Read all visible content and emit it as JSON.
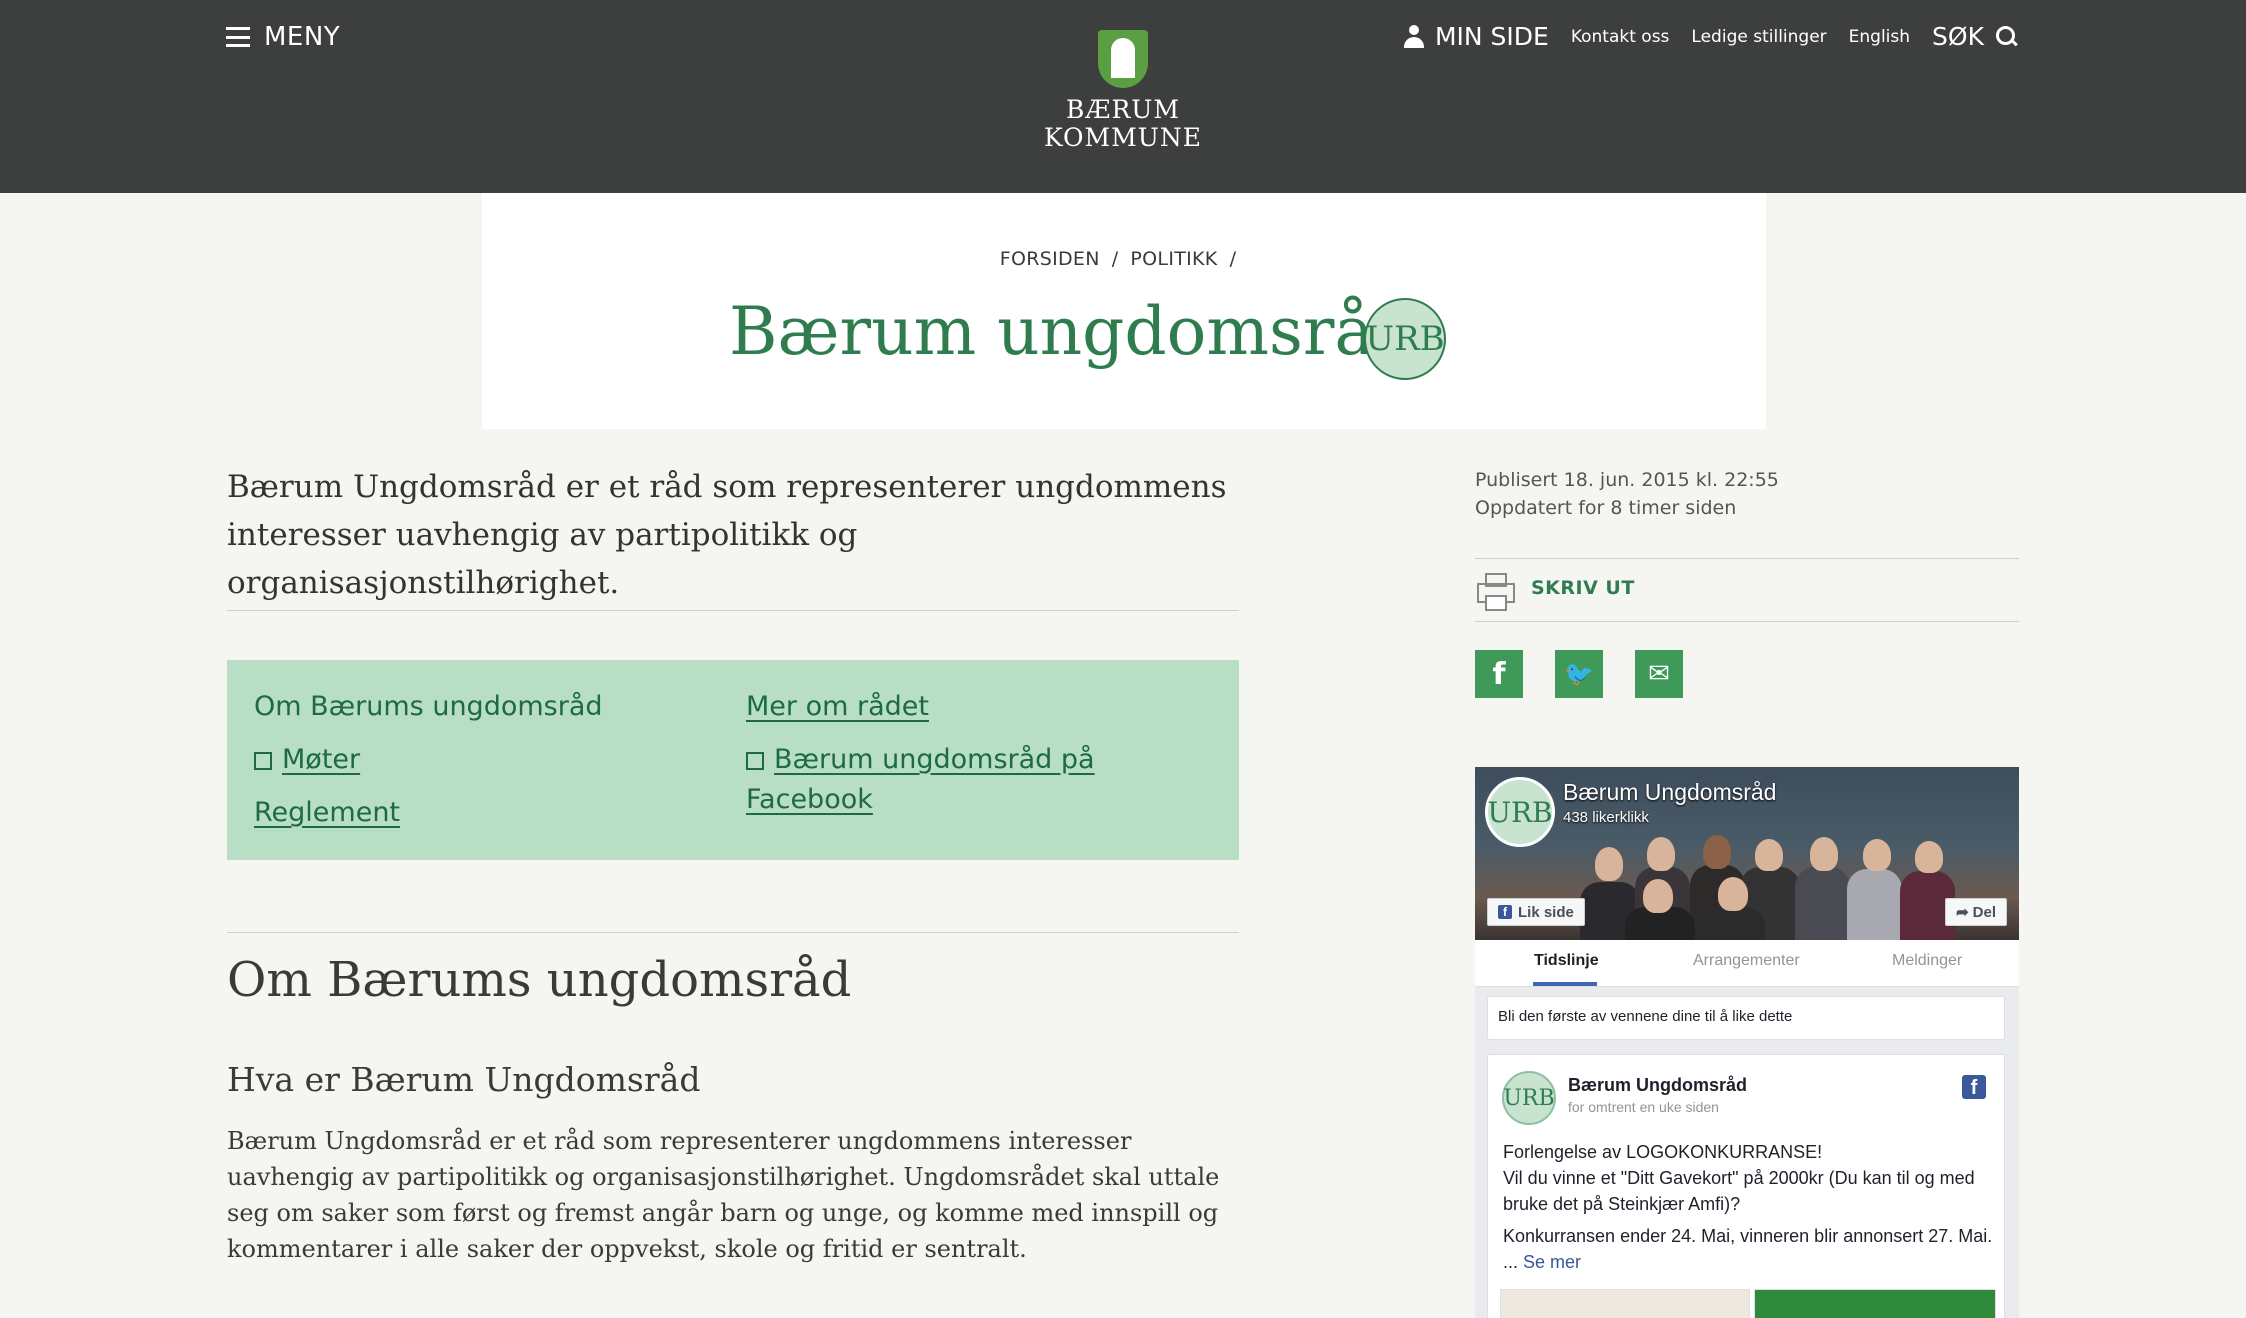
{
  "header": {
    "menu_label": "MENY",
    "logo_line1": "BÆRUM",
    "logo_line2": "KOMMUNE",
    "min_side": "MIN SIDE",
    "links": [
      "Kontakt oss",
      "Ledige stillinger",
      "English"
    ],
    "search_label": "SØK"
  },
  "breadcrumb": [
    "FORSIDEN",
    "POLITIKK"
  ],
  "page": {
    "title": "Bærum ungdomsråd",
    "badge": "URB",
    "intro": "Bærum Ungdomsråd er et råd som representerer ungdommens interesser uavhengig av partipolitikk og organisasjonstilhørighet."
  },
  "quicklinks": {
    "om": "Om Bærums ungdomsråd",
    "moter": "Møter",
    "reglement": "Reglement",
    "mer": "Mer om rådet",
    "facebook": "Bærum ungdomsråd på Facebook"
  },
  "content": {
    "h2": "Om Bærums ungdomsråd",
    "h3": "Hva er Bærum Ungdomsråd",
    "p1": "Bærum Ungdomsråd er et råd som representerer ungdommens interesser uavhengig av partipolitikk og organisasjonstilhørighet. Ungdomsrådet skal uttale seg om saker som først og fremst angår barn og unge, og komme med innspill og kommentarer i alle saker der oppvekst, skole og fritid er sentralt."
  },
  "meta": {
    "published": "Publisert 18. jun. 2015 kl. 22:55",
    "updated": "Oppdatert for 8 timer siden",
    "print": "SKRIV UT"
  },
  "share_icons": [
    "facebook-icon",
    "twitter-icon",
    "email-icon"
  ],
  "facebook_widget": {
    "avatar": "URB",
    "page_name": "Bærum Ungdomsråd",
    "likes": "438 likerklikk",
    "like_button": "Lik side",
    "share_button": "Del",
    "tabs": [
      "Tidslinje",
      "Arrangementer",
      "Meldinger"
    ],
    "friends_text": "Bli den første av vennene dine til å like dette",
    "post": {
      "author": "Bærum Ungdomsråd",
      "time": "for omtrent en uke siden",
      "line1": "Forlengelse av LOGOKONKURRANSE!",
      "line2": "Vil du vinne et \"Ditt Gavekort\" på 2000kr (Du kan til og med bruke det på Steinkjær Amfi)?",
      "line3": "Konkurransen ender 24. Mai, vinneren blir annonsert 27. Mai. ...",
      "see_more": "Se mer"
    }
  },
  "colors": {
    "header_bg": "#3d3f3f",
    "accent_green": "#2f7d4f",
    "linkbox_bg": "#b8dec6"
  }
}
